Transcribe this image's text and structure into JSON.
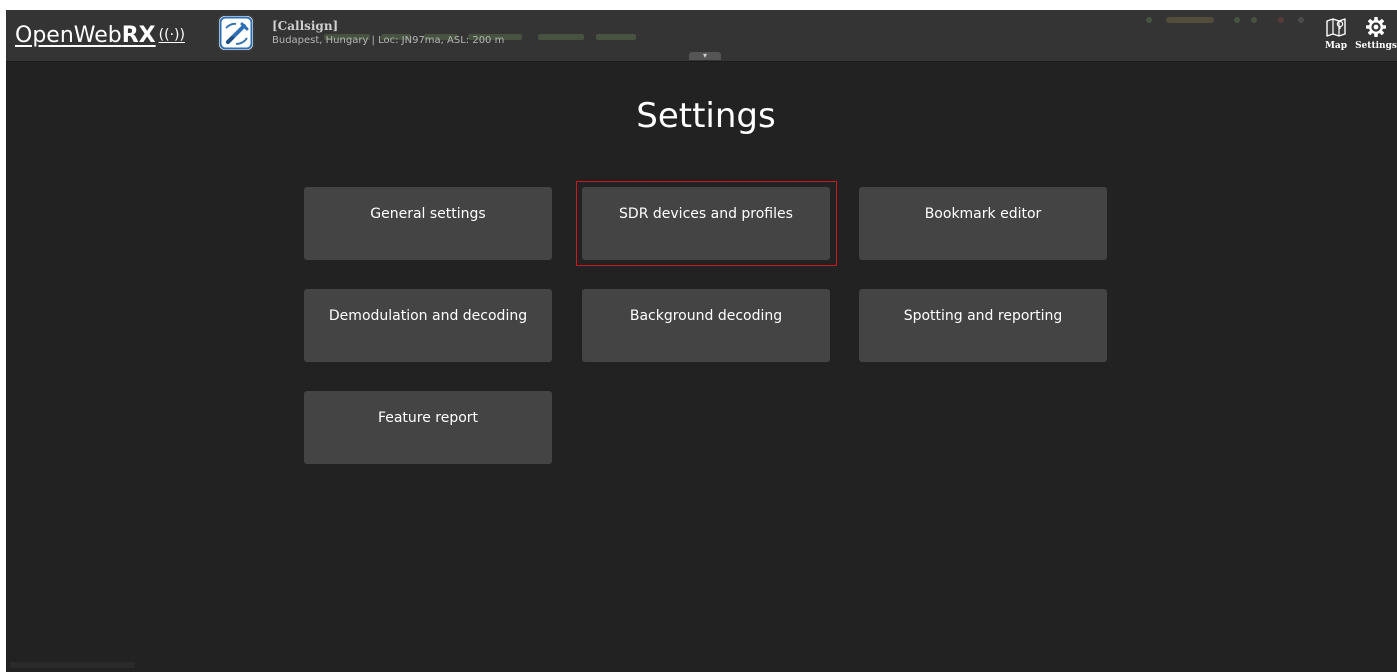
{
  "app": {
    "logo_text_light": "OpenWeb",
    "logo_text_bold": "RX",
    "logo_wave": "((·))"
  },
  "receiver": {
    "callsign": "[Callsign]",
    "location": "Budapest, Hungary | Loc: JN97ma, ASL: 200 m"
  },
  "header": {
    "toggle_glyph": "▾"
  },
  "nav": {
    "map_label": "Map",
    "settings_label": "Settings",
    "map_icon": "map-icon",
    "settings_icon": "gear-icon"
  },
  "page": {
    "title": "Settings"
  },
  "tiles": [
    {
      "label": "General settings"
    },
    {
      "label": "SDR devices and profiles"
    },
    {
      "label": "Bookmark editor"
    },
    {
      "label": "Demodulation and decoding"
    },
    {
      "label": "Background decoding"
    },
    {
      "label": "Spotting and reporting"
    },
    {
      "label": "Feature report"
    }
  ],
  "colors": {
    "background": "#222222",
    "header": "#343434",
    "tile": "#444444",
    "highlight": "#c8191f"
  }
}
